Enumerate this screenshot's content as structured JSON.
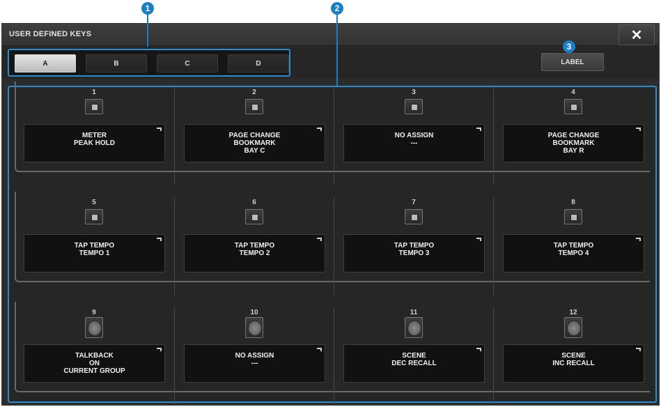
{
  "callouts": [
    "1",
    "2",
    "3"
  ],
  "window": {
    "title": "USER DEFINED KEYS",
    "close_label": "✕"
  },
  "tabs": [
    {
      "label": "A",
      "active": true
    },
    {
      "label": "B",
      "active": false
    },
    {
      "label": "C",
      "active": false
    },
    {
      "label": "D",
      "active": false
    }
  ],
  "label_button": "LABEL",
  "keys": [
    {
      "num": "1",
      "lines": [
        "METER",
        "PEAK HOLD"
      ]
    },
    {
      "num": "2",
      "lines": [
        "PAGE CHANGE",
        "BOOKMARK",
        "BAY C"
      ]
    },
    {
      "num": "3",
      "lines": [
        "NO ASSIGN",
        "---"
      ]
    },
    {
      "num": "4",
      "lines": [
        "PAGE CHANGE",
        "BOOKMARK",
        "BAY R"
      ]
    },
    {
      "num": "5",
      "lines": [
        "TAP TEMPO",
        "TEMPO 1"
      ]
    },
    {
      "num": "6",
      "lines": [
        "TAP TEMPO",
        "TEMPO 2"
      ]
    },
    {
      "num": "7",
      "lines": [
        "TAP TEMPO",
        "TEMPO 3"
      ]
    },
    {
      "num": "8",
      "lines": [
        "TAP TEMPO",
        "TEMPO 4"
      ]
    },
    {
      "num": "9",
      "lines": [
        "TALKBACK",
        "ON",
        "CURRENT GROUP"
      ]
    },
    {
      "num": "10",
      "lines": [
        "NO ASSIGN",
        "---"
      ]
    },
    {
      "num": "11",
      "lines": [
        "SCENE",
        "DEC RECALL"
      ]
    },
    {
      "num": "12",
      "lines": [
        "SCENE",
        "INC RECALL"
      ]
    }
  ],
  "colors": {
    "accent": "#2d8bd0",
    "callout": "#1b7fc4",
    "background": "#2c2c2c"
  }
}
